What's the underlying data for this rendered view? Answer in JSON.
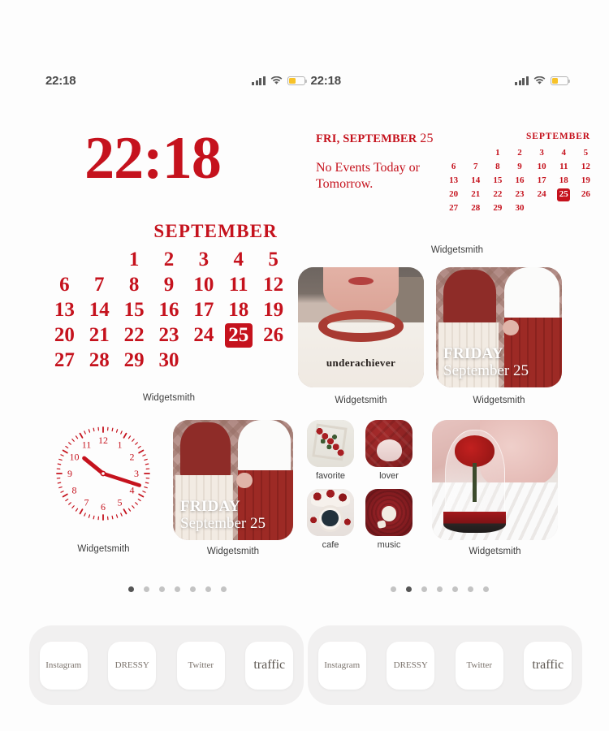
{
  "theme": {
    "red": "#c5121d",
    "battery_yellow": "#f7c229",
    "label_gray": "#3d3d3d"
  },
  "status_bars": {
    "left": {
      "time": "22:18"
    },
    "middle": {
      "time": "22:18",
      "signal": "cellular-bars-icon",
      "wifi": "wifi-icon",
      "battery": "battery-low-power-icon"
    },
    "right": {
      "signal": "cellular-bars-icon",
      "wifi": "wifi-icon",
      "battery": "battery-low-power-icon"
    }
  },
  "left_screen": {
    "digital_clock": {
      "time": "22:18",
      "label": "Widgetsmith"
    },
    "calendar": {
      "month": "SEPTEMBER",
      "label": "Widgetsmith",
      "selected_day": 25,
      "cells": [
        "",
        "",
        "1",
        "2",
        "3",
        "4",
        "5",
        "6",
        "7",
        "8",
        "9",
        "10",
        "11",
        "12",
        "13",
        "14",
        "15",
        "16",
        "17",
        "18",
        "19",
        "20",
        "21",
        "22",
        "23",
        "24",
        "25",
        "26",
        "27",
        "28",
        "29",
        "30",
        "",
        "",
        ""
      ]
    },
    "analog_clock": {
      "label": "Widgetsmith",
      "hours": [
        "12",
        "1",
        "2",
        "3",
        "4",
        "5",
        "6",
        "7",
        "8",
        "9",
        "10",
        "11"
      ],
      "hour_hand_deg": 309,
      "minute_hand_deg": 108
    },
    "photo_widget": {
      "label": "Widgetsmith",
      "overlay_line1": "FRIDAY",
      "overlay_line2": "September 25"
    },
    "page_dots": {
      "count": 7,
      "active": 0
    }
  },
  "right_screen": {
    "events_widget": {
      "header": "FRI, SEPTEMBER ",
      "header_day": "25",
      "body": "No Events Today or Tomorrow.",
      "label": "Widgetsmith"
    },
    "mini_calendar": {
      "month": "SEPTEMBER",
      "selected_day": 25,
      "cells": [
        "",
        "",
        "1",
        "2",
        "3",
        "4",
        "5",
        "6",
        "7",
        "8",
        "9",
        "10",
        "11",
        "12",
        "13",
        "14",
        "15",
        "16",
        "17",
        "18",
        "19",
        "20",
        "21",
        "22",
        "23",
        "24",
        "25",
        "26",
        "27",
        "28",
        "29",
        "30",
        "",
        "",
        ""
      ]
    },
    "photo_shirt": {
      "label": "Widgetsmith",
      "shirt_text": "underachiever"
    },
    "photo_friday": {
      "label": "Widgetsmith",
      "overlay_line1": "FRIDAY",
      "overlay_line2": "September 25"
    },
    "photo_rose": {
      "label": "Widgetsmith"
    },
    "app_icons": [
      {
        "label": "favorite",
        "art": "a-fav"
      },
      {
        "label": "lover",
        "art": "a-lover"
      },
      {
        "label": "cafe",
        "art": "a-cafe"
      },
      {
        "label": "music",
        "art": "a-music"
      }
    ],
    "page_dots": {
      "count": 7,
      "active": 1
    }
  },
  "dock": {
    "left_items": [
      "Instagram",
      "DRESSY",
      "Twitter",
      "traffic"
    ],
    "right_items": [
      "Instagram",
      "DRESSY",
      "Twitter",
      "traffic"
    ]
  }
}
